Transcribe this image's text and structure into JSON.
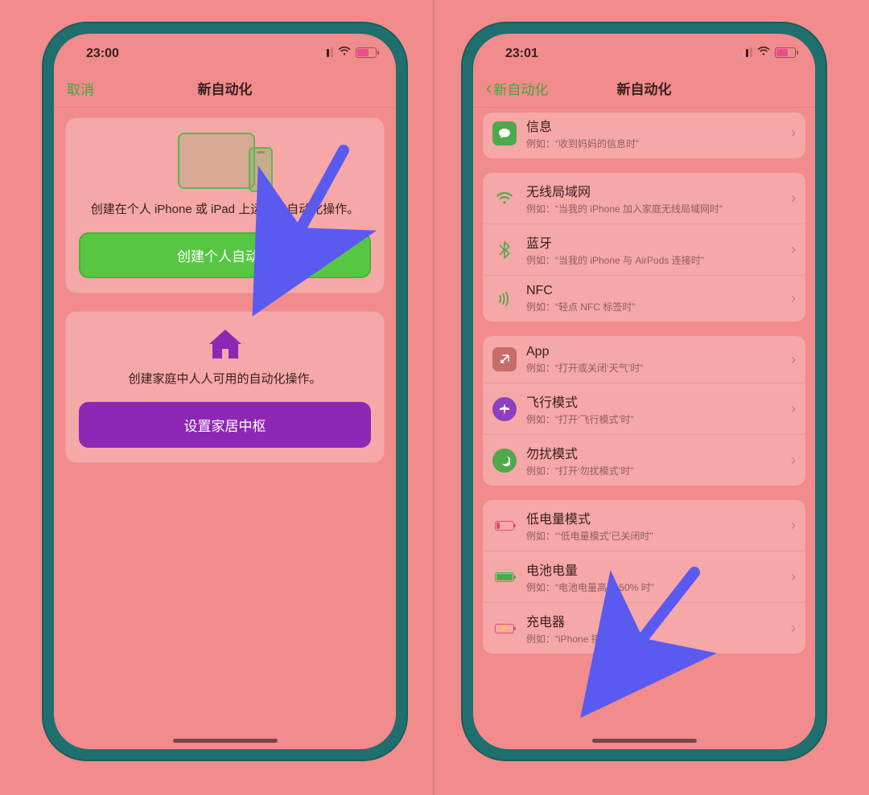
{
  "left": {
    "status_time": "23:00",
    "nav_cancel": "取消",
    "nav_title": "新自动化",
    "personal_desc": "创建在个人 iPhone 或 iPad 上运行的自动化操作。",
    "personal_btn": "创建个人自动化",
    "home_desc": "创建家庭中人人可用的自动化操作。",
    "home_btn": "设置家居中枢"
  },
  "right": {
    "status_time": "23:01",
    "nav_back": "新自动化",
    "nav_title": "新自动化",
    "group0": [
      {
        "icon": "msg",
        "title": "信息",
        "sub": "例如：“收到妈妈的信息时”"
      }
    ],
    "group1": [
      {
        "icon": "wifi",
        "title": "无线局域网",
        "sub": "例如：“当我的 iPhone 加入家庭无线局域网时”"
      },
      {
        "icon": "bt",
        "title": "蓝牙",
        "sub": "例如：“当我的 iPhone 与 AirPods 连接时”"
      },
      {
        "icon": "nfc",
        "title": "NFC",
        "sub": "例如：“轻点 NFC 标签时”"
      }
    ],
    "group2": [
      {
        "icon": "app",
        "title": "App",
        "sub": "例如：“打开或关闭‘天气’时”"
      },
      {
        "icon": "plane",
        "title": "飞行模式",
        "sub": "例如：“打开‘飞行模式’时”"
      },
      {
        "icon": "dnd",
        "title": "勿扰模式",
        "sub": "例如：“打开‘勿扰模式’时”"
      }
    ],
    "group3": [
      {
        "icon": "low",
        "title": "低电量模式",
        "sub": "例如：“‘低电量模式’已关闭时”"
      },
      {
        "icon": "batt",
        "title": "电池电量",
        "sub": "例如：“电池电量高于 50% 时”"
      },
      {
        "icon": "chg",
        "title": "充电器",
        "sub": "例如：“iPhone 接入电源时”"
      }
    ]
  }
}
